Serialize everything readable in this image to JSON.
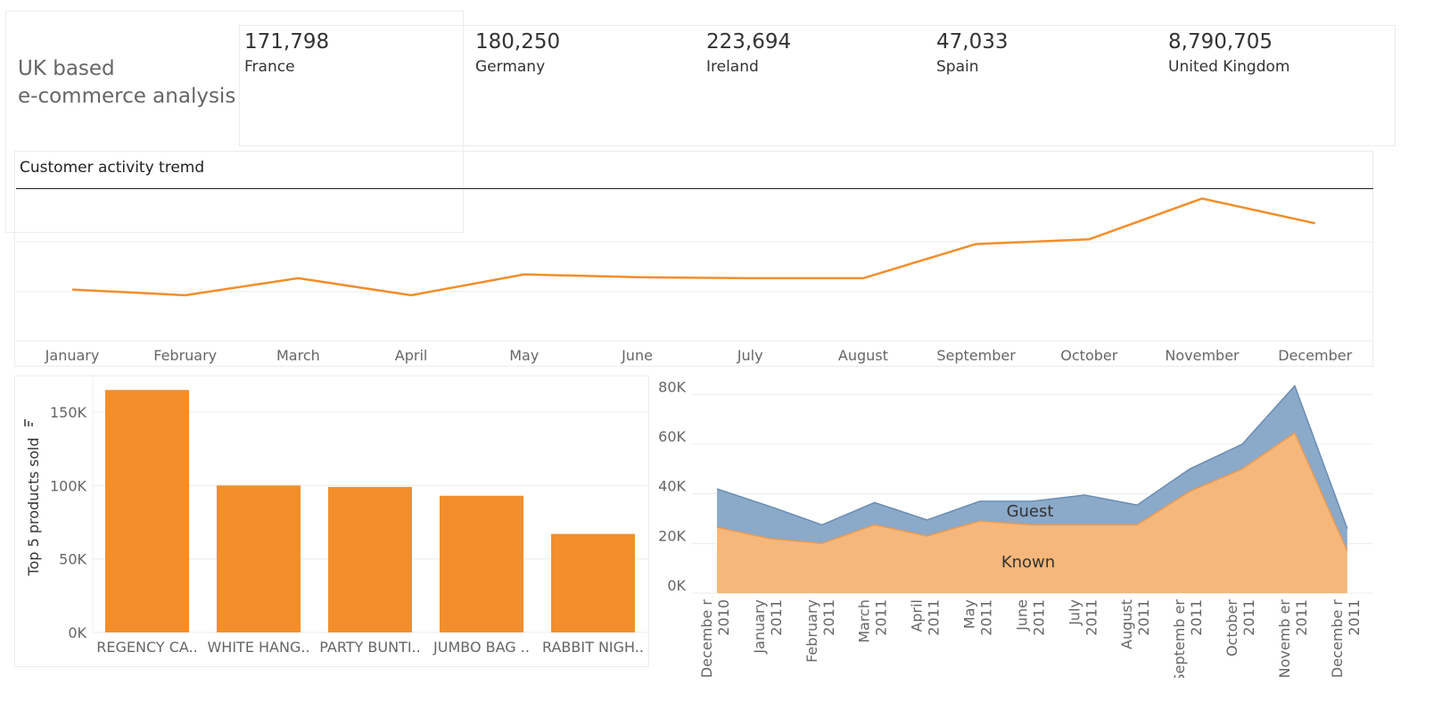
{
  "dashboard": {
    "title_line1": "UK based",
    "title_line2": "e-commerce analysis"
  },
  "kpis": [
    {
      "value": "171,798",
      "label": "France"
    },
    {
      "value": "180,250",
      "label": "Germany"
    },
    {
      "value": "223,694",
      "label": "Ireland"
    },
    {
      "value": "47,033",
      "label": "Spain"
    },
    {
      "value": "8,790,705",
      "label": "United Kingdom"
    }
  ],
  "trend_section": {
    "title": "Customer activity tremd"
  },
  "colors": {
    "orange": "#f28e2b",
    "known_fill": "#f5b77b",
    "guest_fill": "#8ba9c9",
    "guest_line": "#6a8db5",
    "grid": "#ececec",
    "axis_text": "#666666"
  },
  "chart_data": [
    {
      "type": "line",
      "title": "Customer activity tremd",
      "categories": [
        "January",
        "February",
        "March",
        "April",
        "May",
        "June",
        "July",
        "August",
        "September",
        "October",
        "November",
        "December"
      ],
      "series": [
        {
          "values": [
            12200,
            11900,
            12800,
            11900,
            13000,
            12850,
            12800,
            12800,
            14600,
            14850,
            17000,
            15700
          ]
        }
      ],
      "ylim": [
        9500,
        17500
      ],
      "grid": true
    },
    {
      "type": "bar",
      "categories": [
        "REGENCY CA..",
        "WHITE HANG..",
        "PARTY BUNTI..",
        "JUMBO BAG ..",
        "RABBIT NIGH.."
      ],
      "values": [
        165000,
        100000,
        99000,
        93000,
        67000
      ],
      "ylabel": "Top 5 products sold",
      "yticks": [
        "0K",
        "50K",
        "100K",
        "150K"
      ],
      "ylim": [
        0,
        170000
      ],
      "grid": true
    },
    {
      "type": "area",
      "categories": [
        "Decembe r 2010",
        "January 2011",
        "February 2011",
        "March 2011",
        "April 2011",
        "May 2011",
        "June 2011",
        "July 2011",
        "August 2011",
        "Septemb er 2011",
        "October 2011",
        "Novemb er 2011",
        "Decembe r 2011"
      ],
      "series": [
        {
          "name": "Known",
          "values": [
            26500,
            22000,
            20000,
            27500,
            23000,
            29000,
            27500,
            27500,
            27500,
            41000,
            50000,
            64500,
            17000
          ]
        },
        {
          "name": "Guest",
          "values": [
            15500,
            13000,
            7500,
            9000,
            6500,
            8000,
            9500,
            12000,
            8000,
            9000,
            10000,
            19000,
            9000
          ]
        }
      ],
      "yticks": [
        "0K",
        "20K",
        "40K",
        "60K",
        "80K"
      ],
      "ylim": [
        0,
        88000
      ],
      "stacked": true,
      "grid": true
    }
  ]
}
